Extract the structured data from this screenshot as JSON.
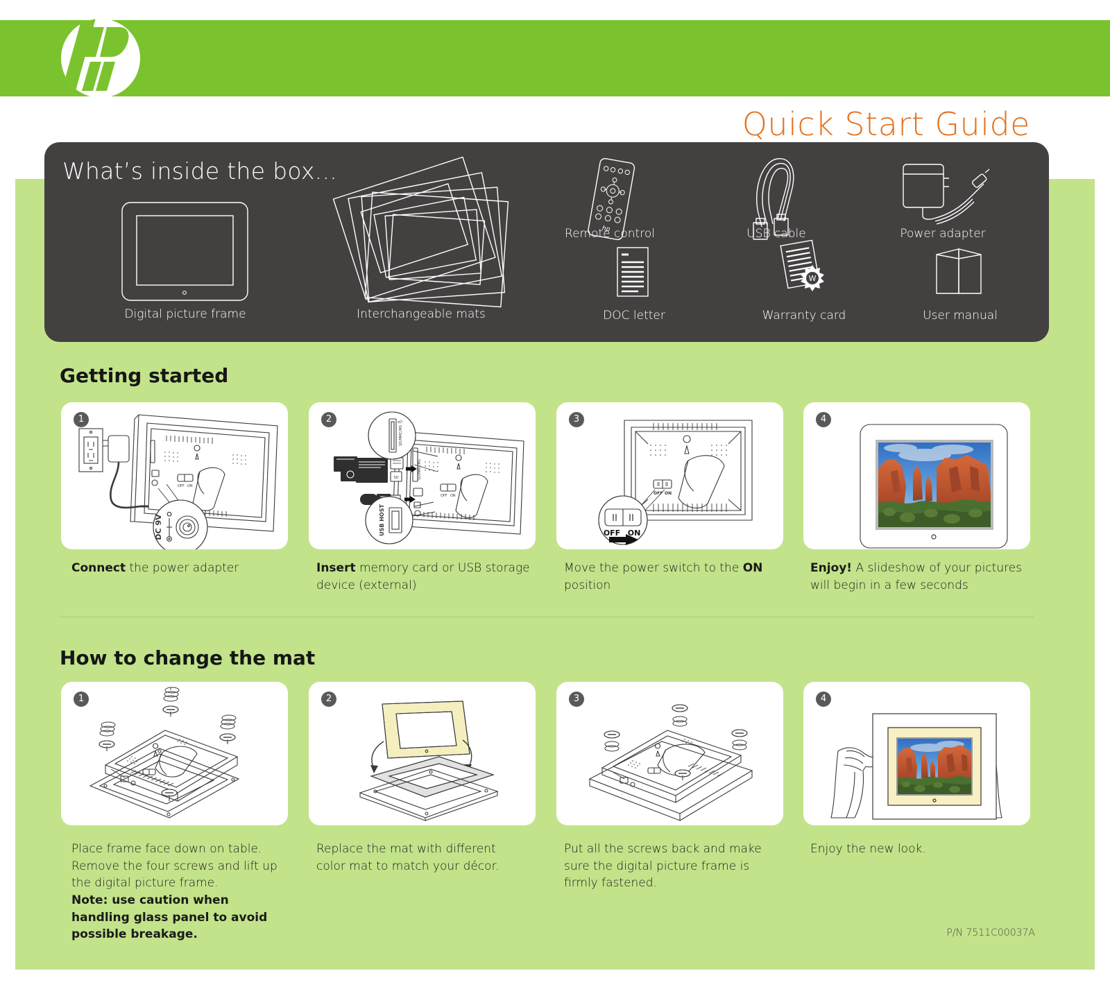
{
  "brand": {
    "logo_text": "hp",
    "logo_name": "hp-logo"
  },
  "header": {
    "title": "Quick Start Guide"
  },
  "box_contents": {
    "heading": "What’s inside the box...",
    "items": [
      {
        "label": "Digital picture frame",
        "icon": "picture-frame-icon"
      },
      {
        "label": "Interchangeable mats",
        "icon": "mats-stack-icon"
      },
      {
        "label": "Remote control",
        "icon": "remote-control-icon"
      },
      {
        "label": "USB cable",
        "icon": "usb-cable-icon"
      },
      {
        "label": "Power adapter",
        "icon": "power-adapter-icon"
      },
      {
        "label": "DOC letter",
        "icon": "document-icon"
      },
      {
        "label": "Warranty card",
        "icon": "warranty-card-icon"
      },
      {
        "label": "User manual",
        "icon": "user-manual-icon"
      }
    ]
  },
  "getting_started": {
    "heading": "Getting started",
    "steps": [
      {
        "number": "1",
        "caption_bold": "Connect",
        "caption_rest": " the power adapter",
        "illustration": "power-adapter-to-outlet-illustration",
        "callout": "DC 9V"
      },
      {
        "number": "2",
        "caption_bold": "Insert",
        "caption_rest": " memory card or USB storage device (external)",
        "illustration": "memory-card-usb-insert-illustration",
        "callout": "USB HOST"
      },
      {
        "number": "3",
        "caption_bold": "",
        "caption_rest": "Move the power switch to the ",
        "caption_bold2": "ON",
        "caption_rest2": " position",
        "illustration": "power-switch-illustration",
        "switch_off": "OFF",
        "switch_on": "ON"
      },
      {
        "number": "4",
        "caption_bold": "Enjoy!",
        "caption_rest": " A slideshow of your pictures will begin in a few seconds",
        "illustration": "frame-slideshow-illustration"
      }
    ]
  },
  "change_mat": {
    "heading": "How to change the mat",
    "steps": [
      {
        "number": "1",
        "caption": "Place frame face down on table. Remove the four screws and lift up the digital picture frame.",
        "note": "Note:  use caution when handling glass panel to avoid possible breakage.",
        "illustration": "remove-screws-illustration"
      },
      {
        "number": "2",
        "caption": "Replace the mat with different color mat to match your décor.",
        "illustration": "swap-mat-illustration"
      },
      {
        "number": "3",
        "caption": "Put all the screws back and make sure the digital picture frame is firmly fastened.",
        "illustration": "reattach-screws-illustration"
      },
      {
        "number": "4",
        "caption": "Enjoy the new look.",
        "illustration": "hands-holding-frame-illustration"
      }
    ]
  },
  "footer": {
    "part_number": "P/N 7511C00037A"
  },
  "colors": {
    "brand_green": "#7ac32e",
    "page_green": "#c2e38a",
    "accent_orange": "#e4711d",
    "dark_panel": "#434040",
    "mat_cream": "#f5efc0"
  }
}
